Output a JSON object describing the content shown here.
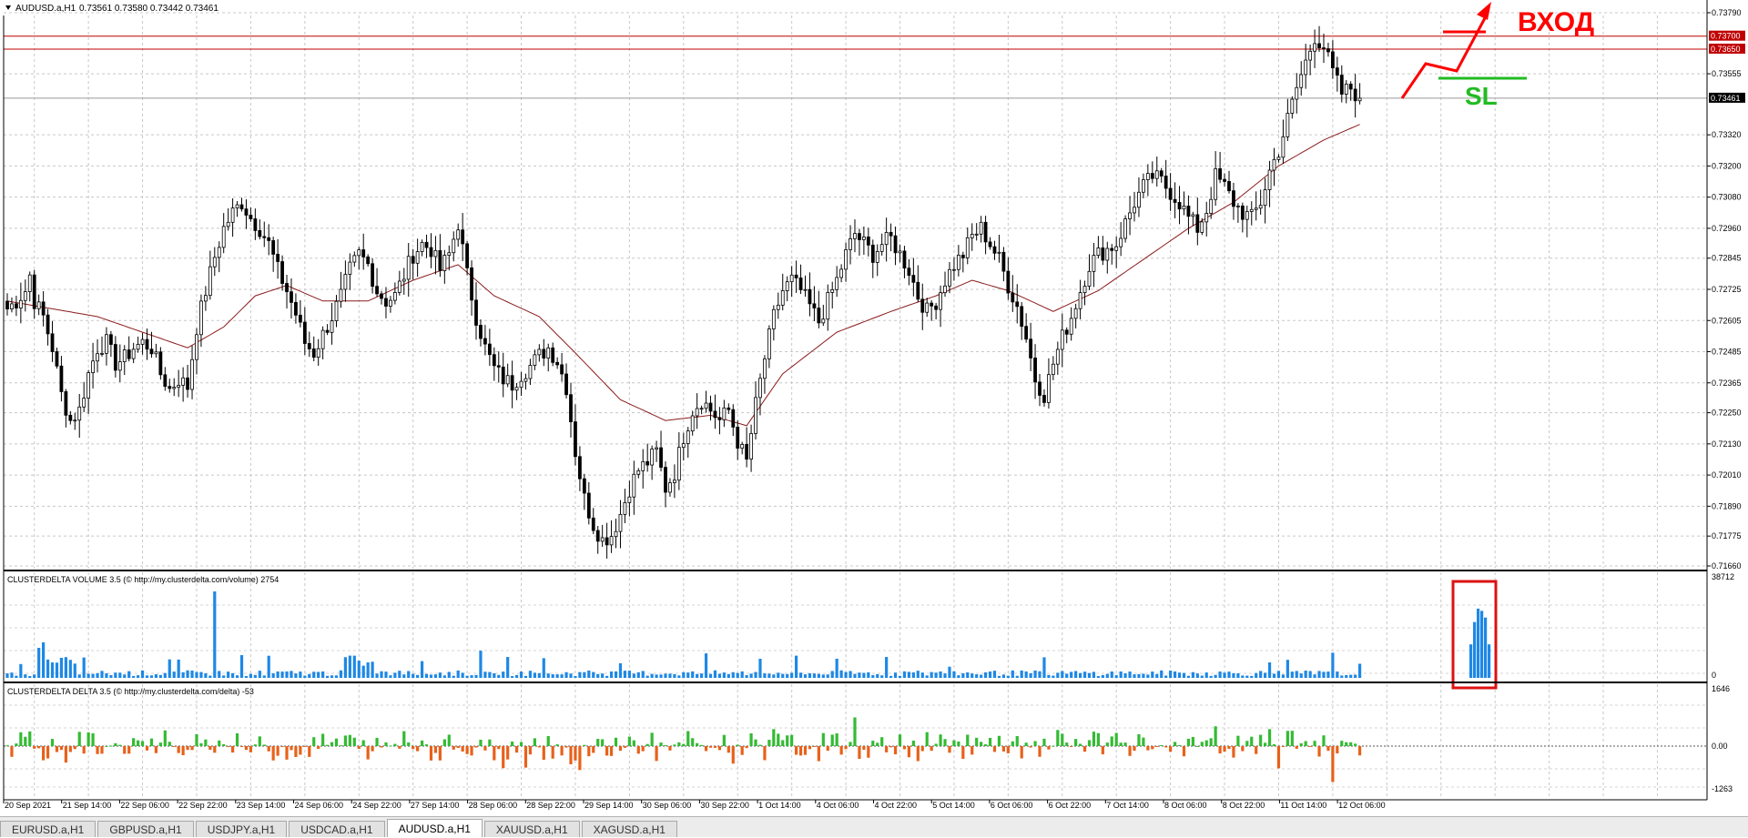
{
  "chart_header": {
    "symbol_label": "AUDUSD.a,H1",
    "ohlc_label": "0.73561 0.73580 0.73442 0.73461"
  },
  "chart_data": [
    {
      "type": "candlestick",
      "series": [
        {
          "name": "AUDUSD.a,H1",
          "values": []
        },
        {
          "name": "",
          "values": []
        }
      ],
      "close_path": [
        [
          0,
          0.7265
        ],
        [
          2,
          0.7268
        ],
        [
          4,
          0.7272
        ],
        [
          5,
          0.7278
        ],
        [
          6,
          0.7268
        ],
        [
          8,
          0.7262
        ],
        [
          10,
          0.725
        ],
        [
          12,
          0.7232
        ],
        [
          14,
          0.7222
        ],
        [
          16,
          0.7226
        ],
        [
          18,
          0.724
        ],
        [
          20,
          0.725
        ],
        [
          22,
          0.7252
        ],
        [
          24,
          0.7244
        ],
        [
          26,
          0.7246
        ],
        [
          28,
          0.725
        ],
        [
          30,
          0.7252
        ],
        [
          32,
          0.725
        ],
        [
          34,
          0.724
        ],
        [
          36,
          0.7234
        ],
        [
          38,
          0.7238
        ],
        [
          40,
          0.7235
        ],
        [
          42,
          0.7258
        ],
        [
          44,
          0.7272
        ],
        [
          46,
          0.7285
        ],
        [
          48,
          0.7296
        ],
        [
          50,
          0.7302
        ],
        [
          52,
          0.7306
        ],
        [
          54,
          0.73
        ],
        [
          56,
          0.7296
        ],
        [
          58,
          0.729
        ],
        [
          60,
          0.728
        ],
        [
          62,
          0.7272
        ],
        [
          64,
          0.7263
        ],
        [
          66,
          0.7252
        ],
        [
          68,
          0.7248
        ],
        [
          70,
          0.7255
        ],
        [
          72,
          0.7262
        ],
        [
          74,
          0.727
        ],
        [
          76,
          0.728
        ],
        [
          78,
          0.7286
        ],
        [
          80,
          0.7282
        ],
        [
          82,
          0.7272
        ],
        [
          84,
          0.7268
        ],
        [
          86,
          0.727
        ],
        [
          88,
          0.7278
        ],
        [
          90,
          0.7286
        ],
        [
          92,
          0.729
        ],
        [
          94,
          0.7288
        ],
        [
          96,
          0.728
        ],
        [
          98,
          0.7286
        ],
        [
          100,
          0.7298
        ],
        [
          102,
          0.7278
        ],
        [
          104,
          0.7262
        ],
        [
          106,
          0.725
        ],
        [
          108,
          0.7242
        ],
        [
          110,
          0.7238
        ],
        [
          112,
          0.7236
        ],
        [
          114,
          0.724
        ],
        [
          116,
          0.7243
        ],
        [
          118,
          0.7247
        ],
        [
          120,
          0.725
        ],
        [
          122,
          0.7245
        ],
        [
          124,
          0.7235
        ],
        [
          126,
          0.721
        ],
        [
          128,
          0.7192
        ],
        [
          130,
          0.7182
        ],
        [
          132,
          0.7176
        ],
        [
          134,
          0.7178
        ],
        [
          136,
          0.7186
        ],
        [
          138,
          0.7196
        ],
        [
          140,
          0.7203
        ],
        [
          142,
          0.7206
        ],
        [
          144,
          0.721
        ],
        [
          146,
          0.7196
        ],
        [
          148,
          0.7202
        ],
        [
          150,
          0.7216
        ],
        [
          152,
          0.7226
        ],
        [
          154,
          0.723
        ],
        [
          156,
          0.7226
        ],
        [
          158,
          0.7222
        ],
        [
          160,
          0.7226
        ],
        [
          162,
          0.7214
        ],
        [
          164,
          0.7206
        ],
        [
          166,
          0.7228
        ],
        [
          168,
          0.7246
        ],
        [
          170,
          0.7262
        ],
        [
          172,
          0.7272
        ],
        [
          174,
          0.7276
        ],
        [
          176,
          0.7272
        ],
        [
          178,
          0.7266
        ],
        [
          180,
          0.726
        ],
        [
          182,
          0.7268
        ],
        [
          184,
          0.7276
        ],
        [
          186,
          0.7286
        ],
        [
          188,
          0.7294
        ],
        [
          190,
          0.729
        ],
        [
          192,
          0.7286
        ],
        [
          194,
          0.729
        ],
        [
          196,
          0.7292
        ],
        [
          198,
          0.7286
        ],
        [
          200,
          0.728
        ],
        [
          202,
          0.727
        ],
        [
          204,
          0.7264
        ],
        [
          206,
          0.7268
        ],
        [
          208,
          0.7276
        ],
        [
          210,
          0.7282
        ],
        [
          212,
          0.7286
        ],
        [
          214,
          0.7293
        ],
        [
          216,
          0.7296
        ],
        [
          218,
          0.729
        ],
        [
          220,
          0.7284
        ],
        [
          222,
          0.7274
        ],
        [
          224,
          0.7266
        ],
        [
          226,
          0.7254
        ],
        [
          228,
          0.7238
        ],
        [
          230,
          0.7232
        ],
        [
          232,
          0.7244
        ],
        [
          234,
          0.7254
        ],
        [
          236,
          0.7262
        ],
        [
          238,
          0.7272
        ],
        [
          240,
          0.7282
        ],
        [
          242,
          0.7286
        ],
        [
          244,
          0.7288
        ],
        [
          246,
          0.729
        ],
        [
          248,
          0.7298
        ],
        [
          250,
          0.7306
        ],
        [
          252,
          0.7312
        ],
        [
          254,
          0.7316
        ],
        [
          256,
          0.7314
        ],
        [
          258,
          0.731
        ],
        [
          260,
          0.7306
        ],
        [
          262,
          0.73
        ],
        [
          264,
          0.7296
        ],
        [
          266,
          0.7303
        ],
        [
          268,
          0.7316
        ],
        [
          270,
          0.7312
        ],
        [
          272,
          0.7306
        ],
        [
          274,
          0.7302
        ],
        [
          276,
          0.73
        ],
        [
          278,
          0.7306
        ],
        [
          280,
          0.7318
        ],
        [
          282,
          0.7326
        ],
        [
          284,
          0.7338
        ],
        [
          286,
          0.735
        ],
        [
          288,
          0.736
        ],
        [
          290,
          0.737
        ],
        [
          292,
          0.7366
        ],
        [
          294,
          0.7356
        ],
        [
          296,
          0.7348
        ],
        [
          298,
          0.735
        ],
        [
          300,
          0.7346
        ]
      ],
      "ma_path": [
        [
          0,
          0.7268
        ],
        [
          20,
          0.7262
        ],
        [
          40,
          0.725
        ],
        [
          48,
          0.7258
        ],
        [
          55,
          0.727
        ],
        [
          62,
          0.7274
        ],
        [
          70,
          0.7268
        ],
        [
          80,
          0.7268
        ],
        [
          90,
          0.7276
        ],
        [
          100,
          0.7282
        ],
        [
          108,
          0.727
        ],
        [
          118,
          0.7262
        ],
        [
          126,
          0.7248
        ],
        [
          136,
          0.723
        ],
        [
          146,
          0.7222
        ],
        [
          156,
          0.7224
        ],
        [
          164,
          0.722
        ],
        [
          172,
          0.724
        ],
        [
          184,
          0.7256
        ],
        [
          196,
          0.7264
        ],
        [
          206,
          0.727
        ],
        [
          214,
          0.7276
        ],
        [
          222,
          0.7272
        ],
        [
          232,
          0.7264
        ],
        [
          242,
          0.7272
        ],
        [
          252,
          0.7284
        ],
        [
          262,
          0.7296
        ],
        [
          272,
          0.7306
        ],
        [
          282,
          0.732
        ],
        [
          292,
          0.733
        ],
        [
          300,
          0.7336
        ]
      ],
      "bar_count": 301,
      "ylim": [
        0.7166,
        0.7379
      ],
      "y_ticks": [
        "0.73790",
        "0.73555",
        "0.73320",
        "0.73200",
        "0.73080",
        "0.72960",
        "0.72845",
        "0.72725",
        "0.72605",
        "0.72485",
        "0.72365",
        "0.72250",
        "0.72130",
        "0.72010",
        "0.71890",
        "0.71775",
        "0.71660"
      ],
      "price_lines": [
        {
          "label": "0.73700",
          "price": 0.737,
          "color": "#c00000"
        },
        {
          "label": "0.73650",
          "price": 0.7365,
          "color": "#c00000"
        },
        {
          "label": "0.73461",
          "price": 0.73461,
          "color": "#000000"
        }
      ],
      "annotations": {
        "entry_text": "ВХОД",
        "sl_text": "SL",
        "entry_color": "#ff0000",
        "sl_color": "#22bb22"
      }
    },
    {
      "type": "bar",
      "title": "CLUSTERDELTA VOLUME 3.5 (© http://my.clusterdelta.com/volume) 2754",
      "ylim": [
        0,
        38712
      ],
      "y_ticks": [
        "38712",
        "0"
      ],
      "color": "#1e88e5",
      "series": [
        {
          "values": []
        }
      ],
      "spike": {
        "bar_index": 46,
        "value": 38712
      },
      "highlight_bars": [
        15000,
        25000,
        31000,
        30000,
        27000,
        15000
      ]
    },
    {
      "type": "bar",
      "title": "CLUSTERDELTA DELTA 3.5 (© http://my.clusterdelta.com/delta) -53",
      "ylim": [
        -1263,
        1646
      ],
      "y_ticks": [
        "1646",
        "0.00",
        "-1263"
      ],
      "positive_color": "#33bb33",
      "negative_color": "#e8611a",
      "series": [
        {
          "values": []
        }
      ]
    }
  ],
  "x_axis_labels": [
    "20 Sep 2021",
    "21 Sep 14:00",
    "22 Sep 06:00",
    "22 Sep 22:00",
    "23 Sep 14:00",
    "24 Sep 06:00",
    "24 Sep 22:00",
    "27 Sep 14:00",
    "28 Sep 06:00",
    "28 Sep 22:00",
    "29 Sep 14:00",
    "30 Sep 06:00",
    "30 Sep 22:00",
    "1 Oct 14:00",
    "4 Oct 06:00",
    "4 Oct 22:00",
    "5 Oct 14:00",
    "6 Oct 06:00",
    "6 Oct 22:00",
    "7 Oct 14:00",
    "8 Oct 06:00",
    "8 Oct 22:00",
    "11 Oct 14:00",
    "12 Oct 06:00"
  ],
  "tabs": [
    {
      "label": "EURUSD.a,H1",
      "active": false
    },
    {
      "label": "GBPUSD.a,H1",
      "active": false
    },
    {
      "label": "USDJPY.a,H1",
      "active": false
    },
    {
      "label": "USDCAD.a,H1",
      "active": false
    },
    {
      "label": "AUDUSD.a,H1",
      "active": true
    },
    {
      "label": "XAUUSD.a,H1",
      "active": false
    },
    {
      "label": "XAGUSD.a,H1",
      "active": false
    }
  ]
}
